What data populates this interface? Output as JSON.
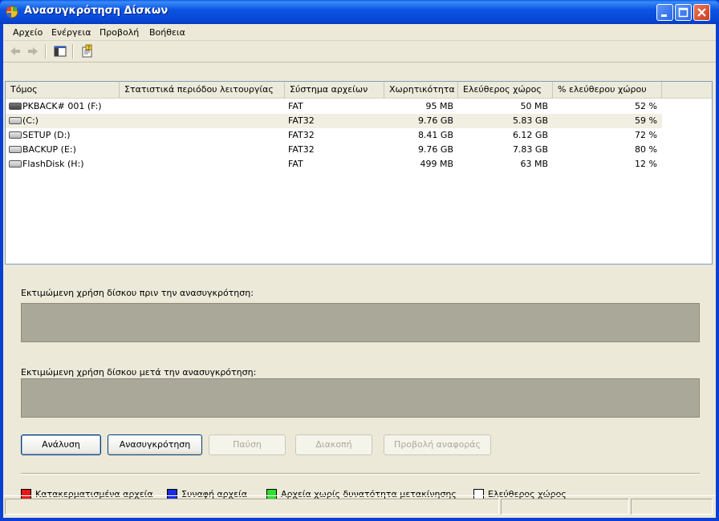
{
  "window": {
    "title": "Ανασυγκρότηση Δίσκων"
  },
  "menu": [
    "Αρχείο",
    "Ενέργεια",
    "Προβολή",
    "Βοήθεια"
  ],
  "columns": [
    "Τόμος",
    "Στατιστικά περιόδου λειτουργίας",
    "Σύστημα αρχείων",
    "Χωρητικότητα",
    "Ελεύθερος χώρος",
    "% ελεύθερου χώρου"
  ],
  "volumes": [
    {
      "name": "PKBACK# 001 (F:)",
      "fs": "FAT",
      "capacity": "95 MB",
      "free": "50 MB",
      "pct": "52 %",
      "icon": "removable-drive-icon"
    },
    {
      "name": "(C:)",
      "fs": "FAT32",
      "capacity": "9.76 GB",
      "free": "5.83 GB",
      "pct": "59 %",
      "icon": "hard-drive-icon"
    },
    {
      "name": "SETUP (D:)",
      "fs": "FAT32",
      "capacity": "8.41 GB",
      "free": "6.12 GB",
      "pct": "72 %",
      "icon": "hard-drive-icon"
    },
    {
      "name": "BACKUP (E:)",
      "fs": "FAT32",
      "capacity": "9.76 GB",
      "free": "7.83 GB",
      "pct": "80 %",
      "icon": "hard-drive-icon"
    },
    {
      "name": "FlashDisk (H:)",
      "fs": "FAT",
      "capacity": "499 MB",
      "free": "63 MB",
      "pct": "12 %",
      "icon": "hard-drive-icon"
    }
  ],
  "labels": {
    "before": "Εκτιμώμενη χρήση δίσκου πριν την ανασυγκρότηση:",
    "after": "Εκτιμώμενη χρήση δίσκου μετά την ανασυγκρότηση:"
  },
  "buttons": {
    "analyze": "Ανάλυση",
    "defragment": "Ανασυγκρότηση",
    "pause": "Παύση",
    "stop": "Διακοπή",
    "view_report": "Προβολή αναφοράς"
  },
  "legend": [
    {
      "label": "Κατακερματισμένα αρχεία",
      "color": "#e81818"
    },
    {
      "label": "Συναφή αρχεία",
      "color": "#1a2de0"
    },
    {
      "label": "Αρχεία χωρίς δυνατότητα μετακίνησης",
      "color": "#2ee02e"
    },
    {
      "label": "Ελεύθερος χώρος",
      "color": "#ffffff"
    }
  ],
  "colors": {
    "titlebar": "#0a5ce8",
    "window_bg": "#ece9d8",
    "usage_bar": "#aaa898"
  }
}
